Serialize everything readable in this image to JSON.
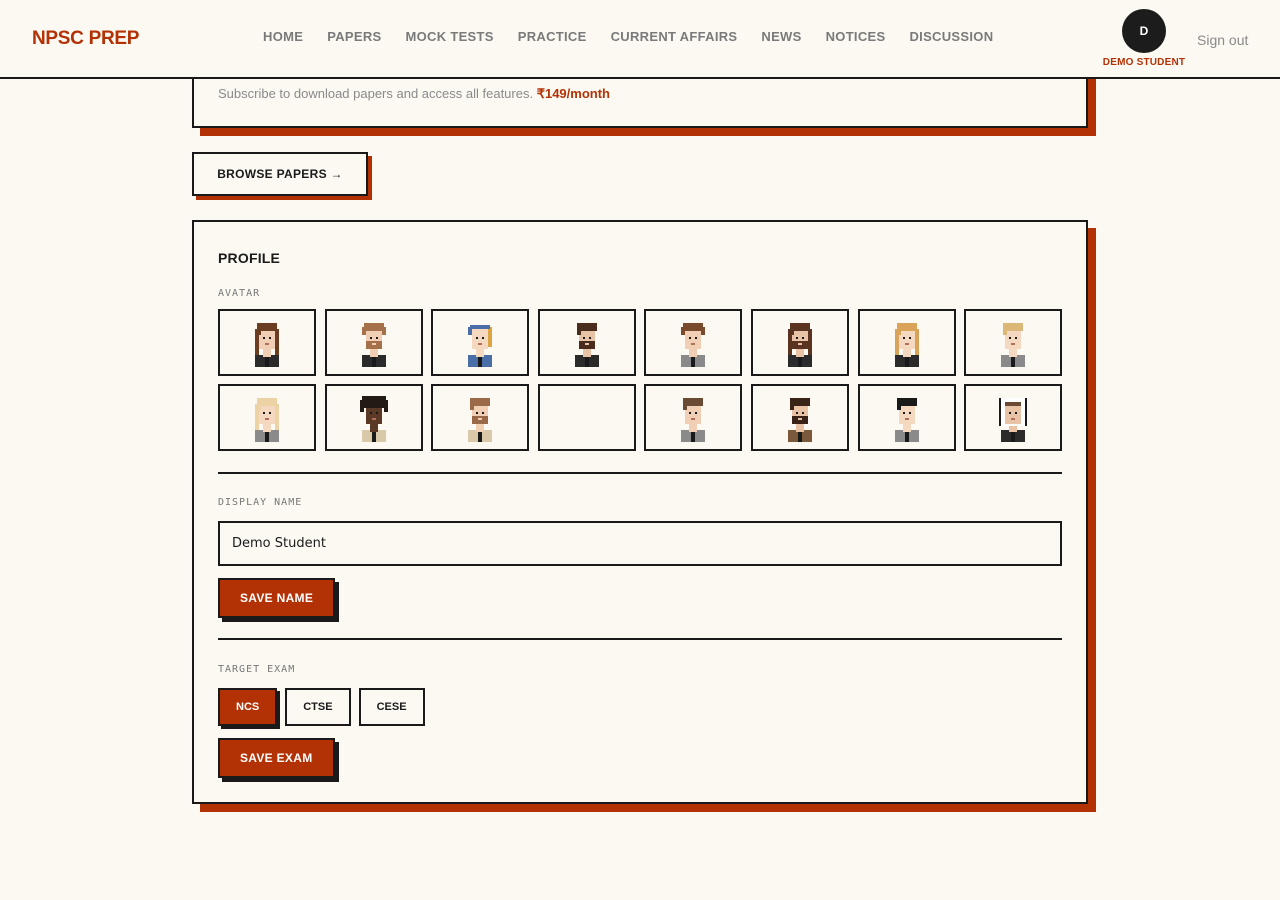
{
  "header": {
    "logo": "NPSC PREP",
    "nav": [
      "HOME",
      "PAPERS",
      "MOCK TESTS",
      "PRACTICE",
      "CURRENT AFFAIRS",
      "NEWS",
      "NOTICES",
      "DISCUSSION"
    ],
    "user_initial": "D",
    "user_name": "DEMO STUDENT",
    "signout": "Sign out"
  },
  "subscribe": {
    "text": "Subscribe to download papers and access all features. ",
    "price": "₹149/month"
  },
  "browse_button": "BROWSE PAPERS →",
  "profile": {
    "title": "PROFILE",
    "avatar_label": "AVATAR",
    "avatars": [
      {
        "name": "avatar-long-brown-hair-icon",
        "hair": "#6b3e22",
        "skin": "#f0cfb4",
        "shirt": "#2b2b2b",
        "style": "long"
      },
      {
        "name": "avatar-bearded-man-icon",
        "hair": "#a5714a",
        "skin": "#f0cfb4",
        "shirt": "#2b2b2b",
        "style": "curly-beard"
      },
      {
        "name": "avatar-blue-headscarf-icon",
        "hair": "#d9a441",
        "skin": "#f4d8bf",
        "shirt": "#4a6ea8",
        "style": "scarf"
      },
      {
        "name": "avatar-dark-beard-man-icon",
        "hair": "#4a2c1c",
        "skin": "#e9c3a5",
        "shirt": "#2b2b2b",
        "style": "beard"
      },
      {
        "name": "avatar-curly-brown-icon",
        "hair": "#7a4a2c",
        "skin": "#f0cfb4",
        "shirt": "#8a8a8a",
        "style": "curly"
      },
      {
        "name": "avatar-long-hair-man-icon",
        "hair": "#5a3420",
        "skin": "#e9c3a5",
        "shirt": "#2b2b2b",
        "style": "long-beard"
      },
      {
        "name": "avatar-blonde-woman-icon",
        "hair": "#d9a45a",
        "skin": "#f4d8bf",
        "shirt": "#2b2b2b",
        "style": "long"
      },
      {
        "name": "avatar-blonde-boy-icon",
        "hair": "#dcb878",
        "skin": "#f4d8bf",
        "shirt": "#8a8a8a",
        "style": "short"
      },
      {
        "name": "avatar-platinum-blonde-icon",
        "hair": "#ecd2a4",
        "skin": "#f4d8bf",
        "shirt": "#8a8a8a",
        "style": "long"
      },
      {
        "name": "avatar-afro-icon",
        "hair": "#231a14",
        "skin": "#5a3a26",
        "shirt": "#d9c9a8",
        "style": "afro"
      },
      {
        "name": "avatar-goatee-man-icon",
        "hair": "#9a6a48",
        "skin": "#f0cfb4",
        "shirt": "#d9c9a8",
        "style": "short-beard"
      },
      {
        "name": "avatar-empty-slot",
        "hair": "",
        "skin": "",
        "shirt": "",
        "style": "none"
      },
      {
        "name": "avatar-short-brown-icon",
        "hair": "#6b4a34",
        "skin": "#f0cfb4",
        "shirt": "#8a8a8a",
        "style": "short"
      },
      {
        "name": "avatar-beard-brown-coat-icon",
        "hair": "#3a2418",
        "skin": "#e9c3a5",
        "shirt": "#7a5a3a",
        "style": "beard"
      },
      {
        "name": "avatar-black-hair-icon",
        "hair": "#1a1a1a",
        "skin": "#f4d8bf",
        "shirt": "#8a8a8a",
        "style": "short"
      },
      {
        "name": "avatar-white-hood-icon",
        "hair": "#ffffff",
        "skin": "#e9c3a5",
        "shirt": "#2b2b2b",
        "style": "hood"
      }
    ],
    "display_name_label": "DISPLAY NAME",
    "display_name_value": "Demo Student",
    "save_name": "SAVE NAME",
    "target_exam_label": "TARGET EXAM",
    "exams": [
      "NCS",
      "CTSE",
      "CESE"
    ],
    "selected_exam": "NCS",
    "save_exam": "SAVE EXAM"
  },
  "colors": {
    "accent": "#b33205",
    "ink": "#1a1a1a",
    "background": "#fcf9f3",
    "muted": "#8a8a8a"
  }
}
